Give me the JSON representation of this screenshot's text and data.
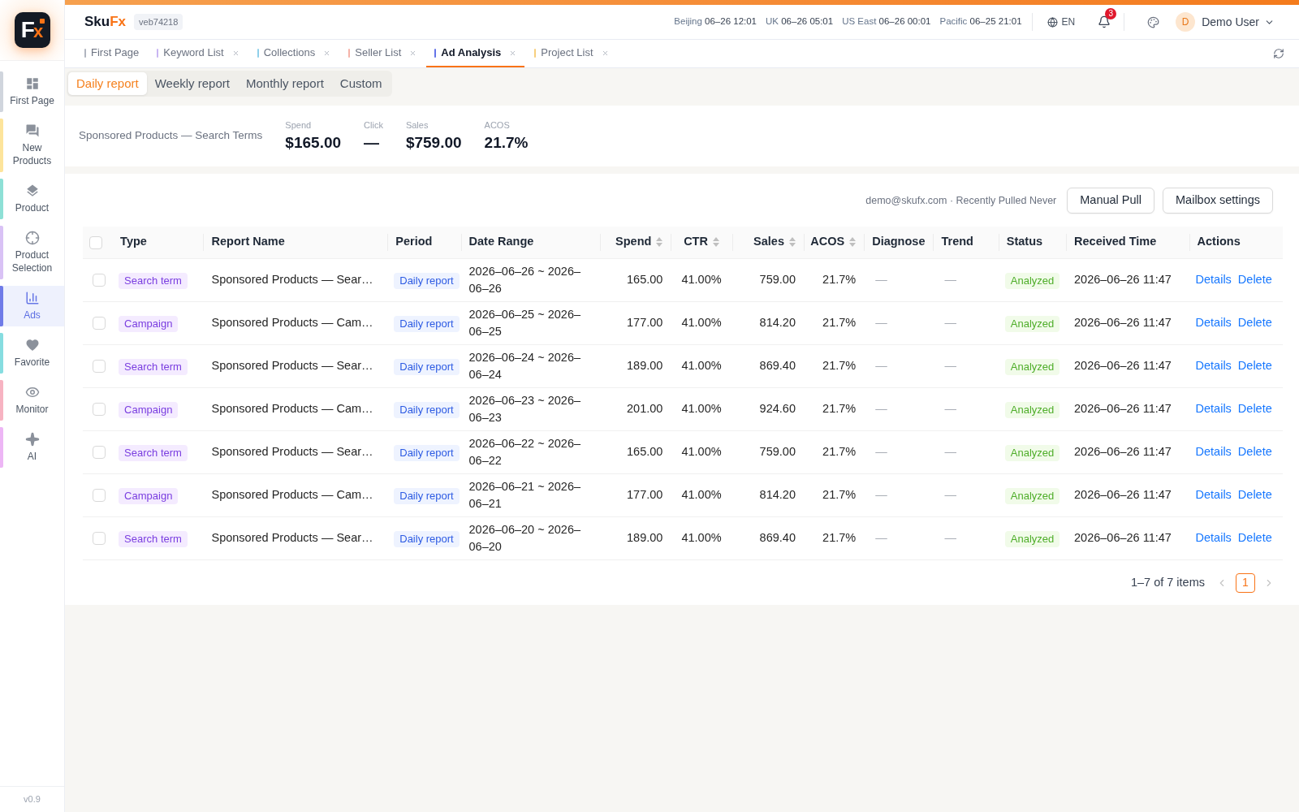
{
  "sidebar": {
    "logo": {
      "text": "F",
      "accent": "x"
    },
    "items": [
      {
        "label": "First Page",
        "color": "#d0d5dd",
        "selected": false
      },
      {
        "label": "New Products",
        "color": "#fde49b",
        "selected": false
      },
      {
        "label": "Product",
        "color": "#8ee0d6",
        "selected": false
      },
      {
        "label": "Product Selection",
        "color": "#d9c2f5",
        "selected": false
      },
      {
        "label": "Ads",
        "color": "#6f7be8",
        "selected": true
      },
      {
        "label": "Favorite",
        "color": "#86dde0",
        "selected": false
      },
      {
        "label": "Monitor",
        "color": "#f7b3c2",
        "selected": false
      },
      {
        "label": "AI",
        "color": "#edb6f5",
        "selected": false
      }
    ],
    "version": "v0.9"
  },
  "header": {
    "brand": {
      "name": "Sku",
      "accent": "Fx"
    },
    "build": "veb74218",
    "clocks": [
      {
        "city": "Beijing",
        "time": "06–26 12:01"
      },
      {
        "city": "UK",
        "time": "06–26 05:01"
      },
      {
        "city": "US East",
        "time": "06–26 00:01"
      },
      {
        "city": "Pacific",
        "time": "06–25 21:01"
      }
    ],
    "language": "EN",
    "notifications": {
      "count": "3"
    },
    "user": {
      "initial": "D",
      "name": "Demo User"
    }
  },
  "tabs": [
    {
      "label": "First Page",
      "color": "#b0b5bf",
      "closable": false,
      "selected": false
    },
    {
      "label": "Keyword List",
      "color": "#c9b6f2",
      "closable": true,
      "selected": false
    },
    {
      "label": "Collections",
      "color": "#8fd0ea",
      "closable": true,
      "selected": false
    },
    {
      "label": "Seller List",
      "color": "#f6b3a8",
      "closable": true,
      "selected": false
    },
    {
      "label": "Ad Analysis",
      "color": "#6574e8",
      "closable": true,
      "selected": true
    },
    {
      "label": "Project List",
      "color": "#f7cf7e",
      "closable": true,
      "selected": false
    }
  ],
  "report_periods": [
    {
      "label": "Daily report",
      "selected": true
    },
    {
      "label": "Weekly report",
      "selected": false
    },
    {
      "label": "Monthly report",
      "selected": false
    },
    {
      "label": "Custom",
      "selected": false
    }
  ],
  "summary": {
    "title": "Sponsored Products — Search Terms",
    "stats": [
      {
        "label": "Spend",
        "value": "$165.00"
      },
      {
        "label": "Click",
        "value": "—"
      },
      {
        "label": "Sales",
        "value": "$759.00"
      },
      {
        "label": "ACOS",
        "value": "21.7%"
      }
    ]
  },
  "reports": {
    "info": "demo@skufx.com · Recently Pulled Never",
    "buttons": [
      "Manual Pull",
      "Mailbox settings"
    ],
    "select_all": {
      "checked": false
    },
    "columns": [
      {
        "label": "Type",
        "sortable": false
      },
      {
        "label": "Report Name",
        "sortable": false
      },
      {
        "label": "Period",
        "sortable": false
      },
      {
        "label": "Date Range",
        "sortable": false
      },
      {
        "label": "Spend",
        "sortable": true
      },
      {
        "label": "CTR",
        "sortable": true
      },
      {
        "label": "Sales",
        "sortable": true
      },
      {
        "label": "ACOS",
        "sortable": true
      },
      {
        "label": "Diagnose",
        "sortable": false
      },
      {
        "label": "Trend",
        "sortable": false
      },
      {
        "label": "Status",
        "sortable": false
      },
      {
        "label": "Received Time",
        "sortable": false
      },
      {
        "label": "Actions",
        "sortable": false
      }
    ],
    "rows": [
      {
        "selected": false,
        "type": "Search term",
        "report_name": "Sponsored Products — Sear…",
        "period": "Daily report",
        "date_range": "2026–06–26 ~ 2026–06–26",
        "spend": "165.00",
        "ctr": "41.00%",
        "sales": "759.00",
        "acos": "21.7%",
        "diagnose": "—",
        "trend": "—",
        "status": "Analyzed",
        "received": "2026–06–26 11:47",
        "actions": [
          "Details",
          "Delete"
        ]
      },
      {
        "selected": false,
        "type": "Campaign",
        "report_name": "Sponsored Products — Cam…",
        "period": "Daily report",
        "date_range": "2026–06–25 ~ 2026–06–25",
        "spend": "177.00",
        "ctr": "41.00%",
        "sales": "814.20",
        "acos": "21.7%",
        "diagnose": "—",
        "trend": "—",
        "status": "Analyzed",
        "received": "2026–06–26 11:47",
        "actions": [
          "Details",
          "Delete"
        ]
      },
      {
        "selected": false,
        "type": "Search term",
        "report_name": "Sponsored Products — Sear…",
        "period": "Daily report",
        "date_range": "2026–06–24 ~ 2026–06–24",
        "spend": "189.00",
        "ctr": "41.00%",
        "sales": "869.40",
        "acos": "21.7%",
        "diagnose": "—",
        "trend": "—",
        "status": "Analyzed",
        "received": "2026–06–26 11:47",
        "actions": [
          "Details",
          "Delete"
        ]
      },
      {
        "selected": false,
        "type": "Campaign",
        "report_name": "Sponsored Products — Cam…",
        "period": "Daily report",
        "date_range": "2026–06–23 ~ 2026–06–23",
        "spend": "201.00",
        "ctr": "41.00%",
        "sales": "924.60",
        "acos": "21.7%",
        "diagnose": "—",
        "trend": "—",
        "status": "Analyzed",
        "received": "2026–06–26 11:47",
        "actions": [
          "Details",
          "Delete"
        ]
      },
      {
        "selected": false,
        "type": "Search term",
        "report_name": "Sponsored Products — Sear…",
        "period": "Daily report",
        "date_range": "2026–06–22 ~ 2026–06–22",
        "spend": "165.00",
        "ctr": "41.00%",
        "sales": "759.00",
        "acos": "21.7%",
        "diagnose": "—",
        "trend": "—",
        "status": "Analyzed",
        "received": "2026–06–26 11:47",
        "actions": [
          "Details",
          "Delete"
        ]
      },
      {
        "selected": false,
        "type": "Campaign",
        "report_name": "Sponsored Products — Cam…",
        "period": "Daily report",
        "date_range": "2026–06–21 ~ 2026–06–21",
        "spend": "177.00",
        "ctr": "41.00%",
        "sales": "814.20",
        "acos": "21.7%",
        "diagnose": "—",
        "trend": "—",
        "status": "Analyzed",
        "received": "2026–06–26 11:47",
        "actions": [
          "Details",
          "Delete"
        ]
      },
      {
        "selected": false,
        "type": "Search term",
        "report_name": "Sponsored Products — Sear…",
        "period": "Daily report",
        "date_range": "2026–06–20 ~ 2026–06–20",
        "spend": "189.00",
        "ctr": "41.00%",
        "sales": "869.40",
        "acos": "21.7%",
        "diagnose": "—",
        "trend": "—",
        "status": "Analyzed",
        "received": "2026–06–26 11:47",
        "actions": [
          "Details",
          "Delete"
        ]
      }
    ],
    "pagination": {
      "range": "1–7 of 7 items",
      "prev_disabled": true,
      "next_disabled": true,
      "pages": [
        {
          "label": "1",
          "selected": true
        }
      ]
    }
  }
}
